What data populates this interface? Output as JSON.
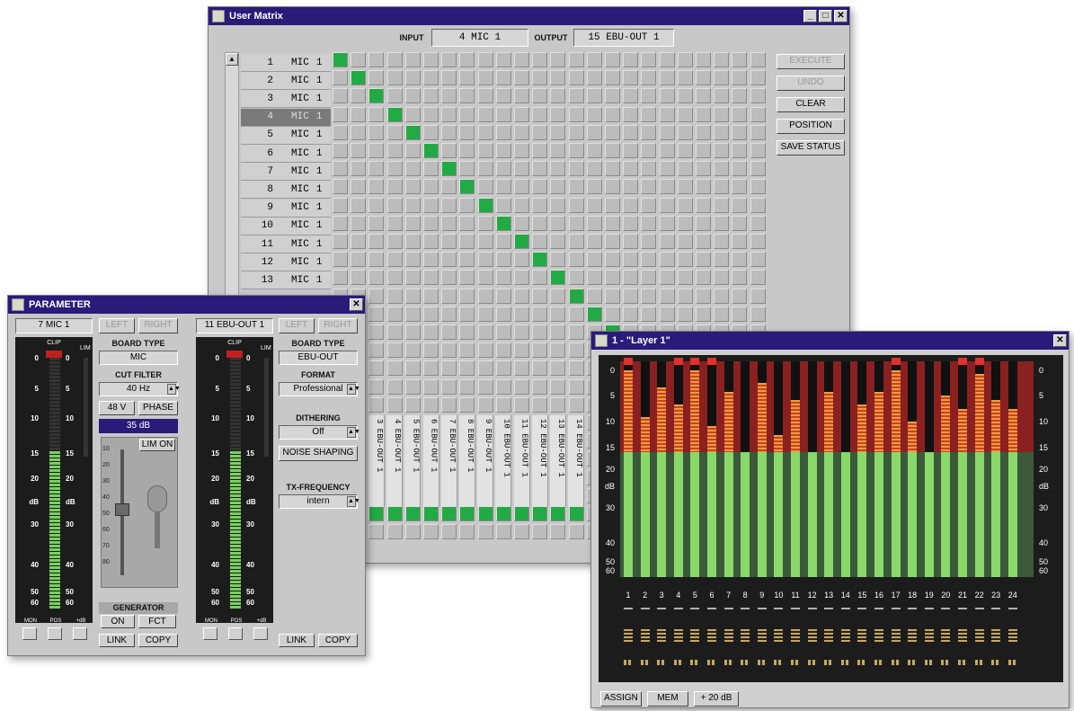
{
  "matrix": {
    "title": "User Matrix",
    "input_label": "INPUT",
    "input_value": "4   MIC   1",
    "output_label": "OUTPUT",
    "output_value": "15 EBU-OUT 1",
    "buttons": [
      "EXECUTE",
      "UNDO",
      "CLEAR",
      "POSITION",
      "SAVE STATUS"
    ],
    "rows": [
      {
        "n": "1",
        "t": "MIC",
        "c": "1"
      },
      {
        "n": "2",
        "t": "MIC",
        "c": "1"
      },
      {
        "n": "3",
        "t": "MIC",
        "c": "1"
      },
      {
        "n": "4",
        "t": "MIC",
        "c": "1"
      },
      {
        "n": "5",
        "t": "MIC",
        "c": "1"
      },
      {
        "n": "6",
        "t": "MIC",
        "c": "1"
      },
      {
        "n": "7",
        "t": "MIC",
        "c": "1"
      },
      {
        "n": "8",
        "t": "MIC",
        "c": "1"
      },
      {
        "n": "9",
        "t": "MIC",
        "c": "1"
      },
      {
        "n": "10",
        "t": "MIC",
        "c": "1"
      },
      {
        "n": "11",
        "t": "MIC",
        "c": "1"
      },
      {
        "n": "12",
        "t": "MIC",
        "c": "1"
      },
      {
        "n": "13",
        "t": "MIC",
        "c": "1"
      }
    ],
    "selected_row": 3,
    "column_labels": [
      "3 EBU-OUT 1",
      "4 EBU-OUT 1",
      "5 EBU-OUT 1",
      "6 EBU-OUT 1",
      "7 EBU-OUT 1",
      "8 EBU-OUT 1",
      "9 EBU-OUT 1",
      "10 EBU-OUT 1",
      "11 EBU-OUT 1",
      "12 EBU-OUT 1",
      "13 EBU-OUT 1",
      "14 EBU-OUT 1"
    ],
    "active_color": "#22aa44"
  },
  "parameter": {
    "title": "PARAMETER",
    "left_channel": "7  MIC  1",
    "right_channel": "11 EBU-OUT 1",
    "left_btn": "LEFT",
    "right_btn": "RIGHT",
    "board_type_label": "BOARD TYPE",
    "board_type_left": "MIC",
    "board_type_right": "EBU-OUT",
    "cut_filter_label": "CUT FILTER",
    "cut_filter_value": "40 Hz",
    "btn_48v": "48 V",
    "btn_phase": "PHASE",
    "gain_value": "35 dB",
    "lim_on": "LIM ON",
    "generator_label": "GENERATOR",
    "gen_on": "ON",
    "gen_fct": "FCT",
    "format_label": "FORMAT",
    "format_value": "Professional",
    "dithering_label": "DITHERING",
    "dithering_value": "Off",
    "noise_shaping": "NOISE SHAPING",
    "tx_label": "TX-FREQUENCY",
    "tx_value": "intern",
    "link": "LINK",
    "copy": "COPY",
    "clip": "CLIP",
    "lim": "LIM",
    "scale": [
      "0",
      "5",
      "10",
      "15",
      "20",
      "dB",
      "30",
      "40",
      "50",
      "60"
    ],
    "fader_scale": [
      "10",
      "20",
      "30",
      "40",
      "50",
      "60",
      "70",
      "80"
    ],
    "bottom_labels": [
      "MON",
      "POS",
      "+dB"
    ]
  },
  "layer": {
    "title": "1 - \"Layer 1\"",
    "channels": [
      "1",
      "2",
      "3",
      "4",
      "5",
      "6",
      "7",
      "8",
      "9",
      "10",
      "11",
      "12",
      "13",
      "14",
      "15",
      "16",
      "17",
      "18",
      "19",
      "20",
      "21",
      "22",
      "23",
      "24"
    ],
    "levels": [
      0.96,
      0.74,
      0.88,
      0.8,
      0.96,
      0.7,
      0.86,
      0.56,
      0.9,
      0.66,
      0.82,
      0.52,
      0.86,
      0.5,
      0.8,
      0.86,
      0.96,
      0.72,
      0.48,
      0.84,
      0.78,
      0.94,
      0.82,
      0.78
    ],
    "clips": [
      true,
      false,
      false,
      true,
      true,
      true,
      false,
      false,
      false,
      false,
      false,
      false,
      false,
      false,
      false,
      false,
      true,
      false,
      false,
      false,
      true,
      true,
      false,
      false
    ],
    "scale": [
      "0",
      "5",
      "10",
      "15",
      "20",
      "dB",
      "30",
      "40",
      "50",
      "60"
    ],
    "btn_assign": "ASSIGN",
    "btn_mem": "MEM",
    "btn_db": "+ 20 dB"
  }
}
